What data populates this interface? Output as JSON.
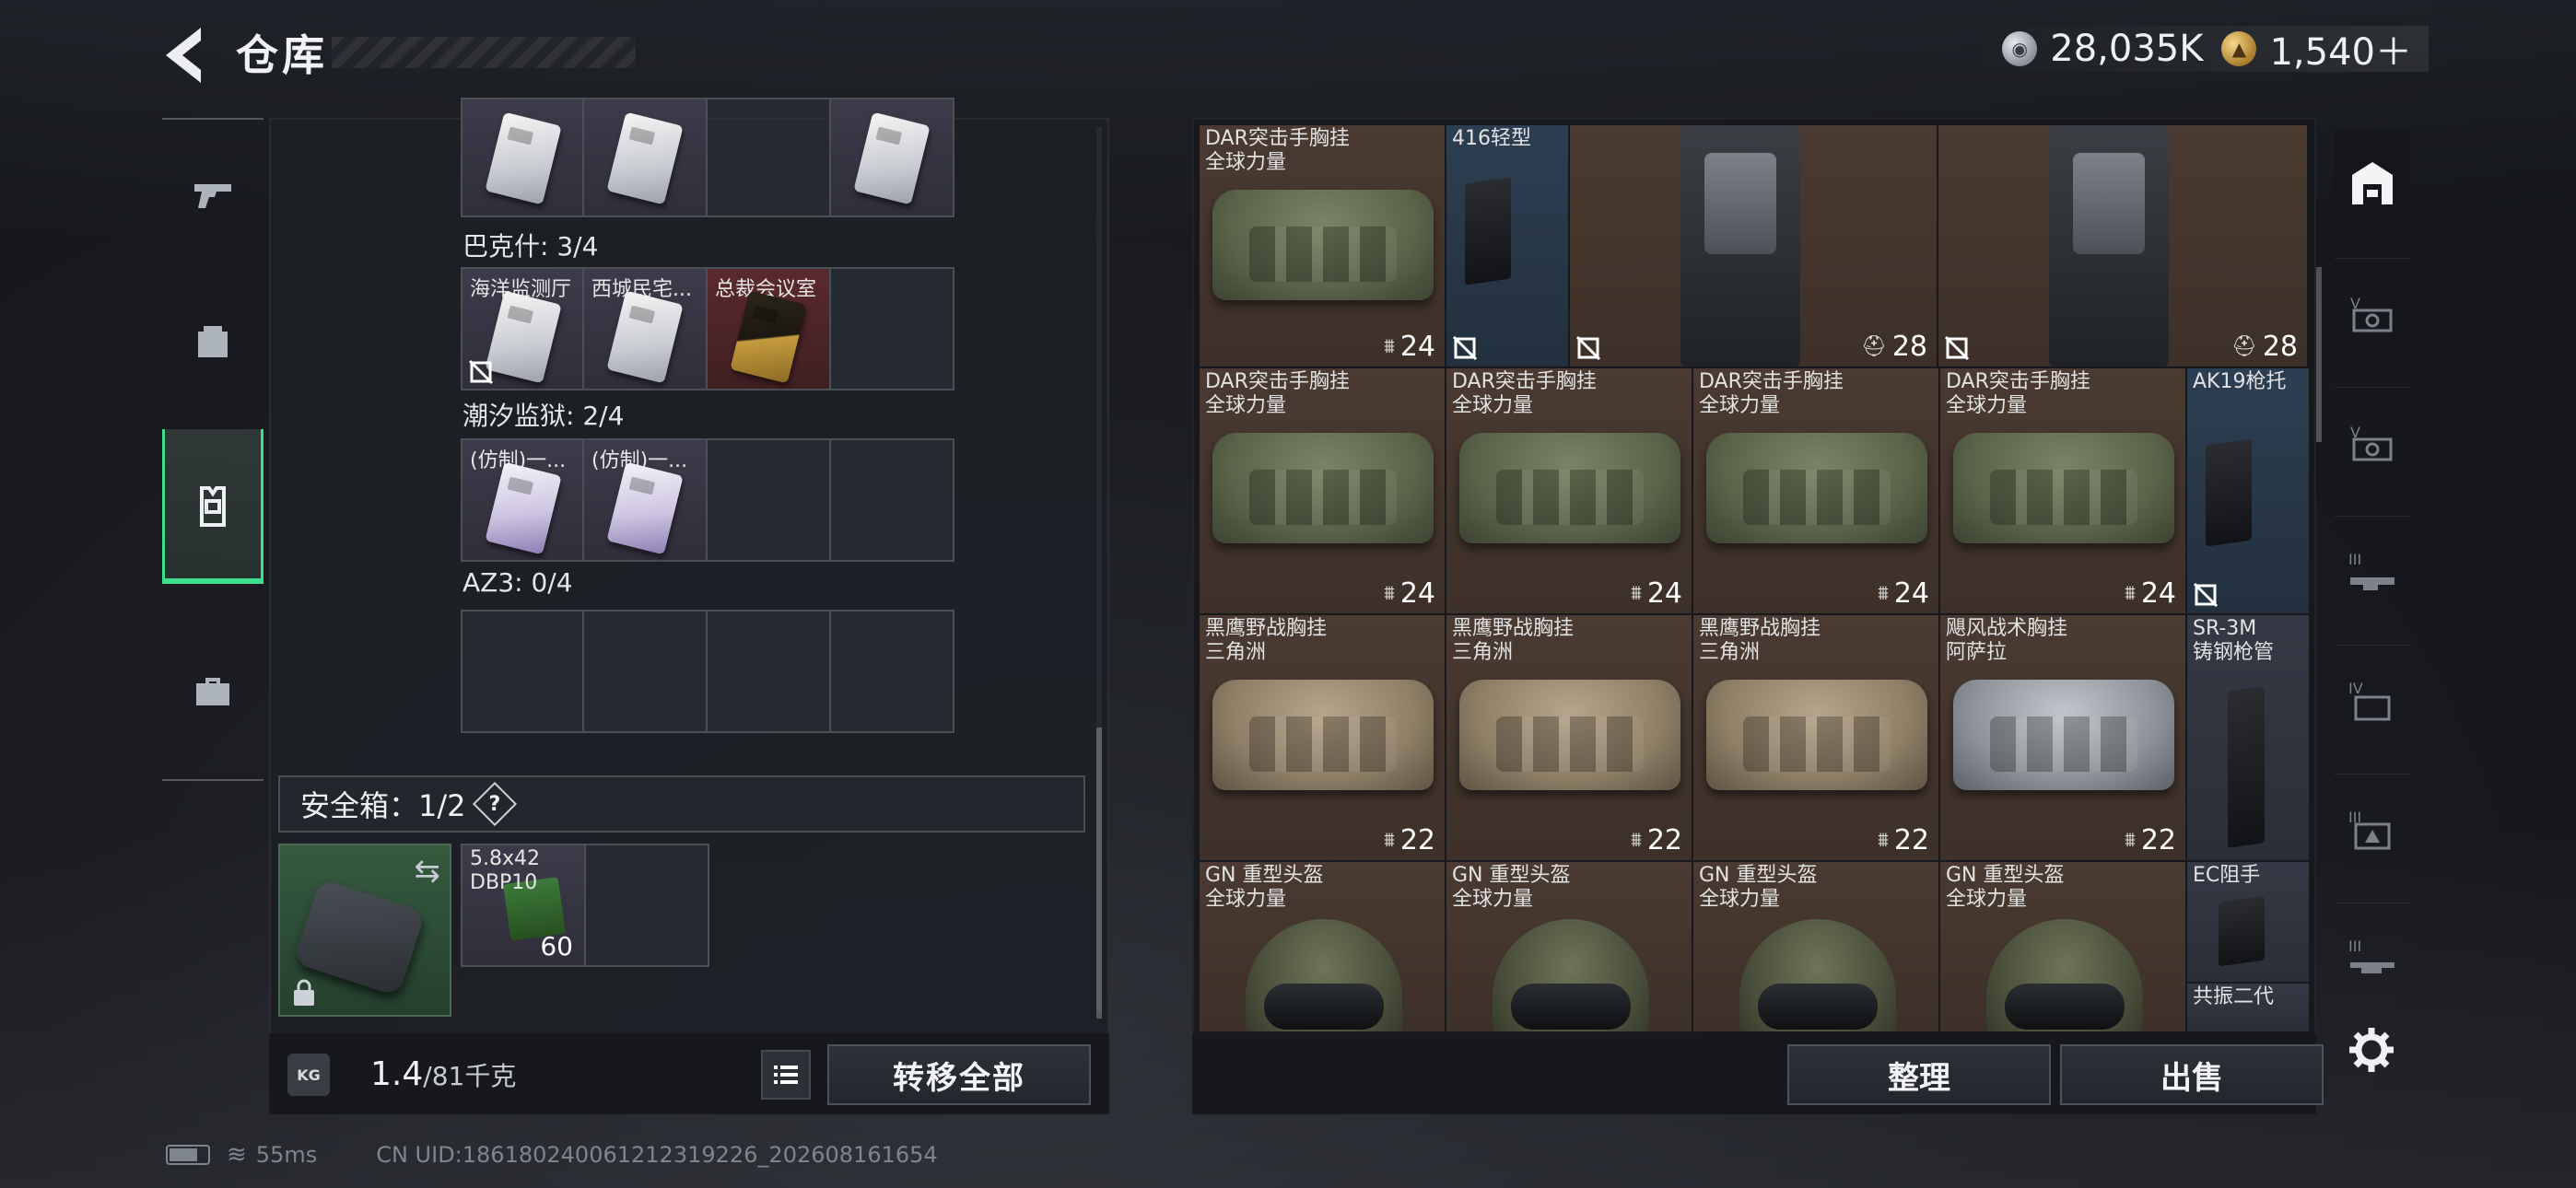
{
  "header": {
    "title": "仓库",
    "currency": [
      {
        "icon": "silver-coin-icon",
        "value": "28,035K"
      },
      {
        "icon": "gold-coin-icon",
        "value": "1,540＋"
      }
    ]
  },
  "left_tabs": [
    "pistol-icon",
    "backpack-icon",
    "vest-icon",
    "toolbox-icon"
  ],
  "key_sections": [
    {
      "label": "巴克什: 3/4",
      "slots": [
        "海洋监测厅",
        "西城民宅...",
        "总裁会议室",
        ""
      ]
    },
    {
      "label": "潮汐监狱: 2/4",
      "slots": [
        "(仿制)一...",
        "(仿制)一...",
        "",
        ""
      ]
    },
    {
      "label": "AZ3: 0/4",
      "slots": [
        "",
        "",
        "",
        ""
      ]
    }
  ],
  "safe": {
    "label": "安全箱：1/2",
    "help": "?",
    "swap_icon": "⇆",
    "ammo_name_1": "5.8x42",
    "ammo_name_2": "DBP10",
    "ammo_count": "60"
  },
  "footer_left": {
    "kg_icon": "KG",
    "weight_value": "1.4",
    "weight_total": "/81千克",
    "transfer_all": "转移全部"
  },
  "footer_right": {
    "sort": "整理",
    "sell": "出售"
  },
  "items": [
    {
      "n1": "DAR突击手胸挂",
      "n2": "全球力量",
      "count": "24",
      "icon": "weight-icon"
    },
    {
      "n1": "416轻型",
      "n2": "",
      "count": "",
      "icon": ""
    },
    {
      "n1": "",
      "n2": "",
      "count": "28",
      "icon": "helmet-mini-icon"
    },
    {
      "n1": "",
      "n2": "",
      "count": "28",
      "icon": "helmet-mini-icon"
    },
    {
      "n1": "DAR突击手胸挂",
      "n2": "全球力量",
      "count": "24",
      "icon": "weight-icon"
    },
    {
      "n1": "DAR突击手胸挂",
      "n2": "全球力量",
      "count": "24",
      "icon": "weight-icon"
    },
    {
      "n1": "DAR突击手胸挂",
      "n2": "全球力量",
      "count": "24",
      "icon": "weight-icon"
    },
    {
      "n1": "DAR突击手胸挂",
      "n2": "全球力量",
      "count": "24",
      "icon": "weight-icon"
    },
    {
      "n1": "AK19枪托",
      "n2": "",
      "count": "",
      "icon": ""
    },
    {
      "n1": "黑鹰野战胸挂",
      "n2": "三角洲",
      "count": "22",
      "icon": "weight-icon"
    },
    {
      "n1": "黑鹰野战胸挂",
      "n2": "三角洲",
      "count": "22",
      "icon": "weight-icon"
    },
    {
      "n1": "黑鹰野战胸挂",
      "n2": "三角洲",
      "count": "22",
      "icon": "weight-icon"
    },
    {
      "n1": "飓风战术胸挂",
      "n2": "阿萨拉",
      "count": "22",
      "icon": "weight-icon"
    },
    {
      "n1": "SR-3M",
      "n2": "铸钢枪管",
      "count": "",
      "icon": ""
    },
    {
      "n1": "GN 重型头盔",
      "n2": "全球力量",
      "count": "",
      "icon": ""
    },
    {
      "n1": "GN 重型头盔",
      "n2": "全球力量",
      "count": "",
      "icon": ""
    },
    {
      "n1": "GN 重型头盔",
      "n2": "全球力量",
      "count": "",
      "icon": ""
    },
    {
      "n1": "GN 重型头盔",
      "n2": "全球力量",
      "count": "",
      "icon": ""
    },
    {
      "n1": "EC阻手",
      "n2": "",
      "count": "",
      "icon": ""
    },
    {
      "n1": "共振二代",
      "n2": "",
      "count": "",
      "icon": ""
    }
  ],
  "right_tabs": [
    "storage-icon",
    "tab-v-1",
    "tab-v-2",
    "tab-iii-1",
    "tab-iv",
    "tab-iii-2",
    "tab-iii-3"
  ],
  "status": {
    "ping": "55ms",
    "uid": "CN UID:18618024006121231922​6_202608161654"
  }
}
